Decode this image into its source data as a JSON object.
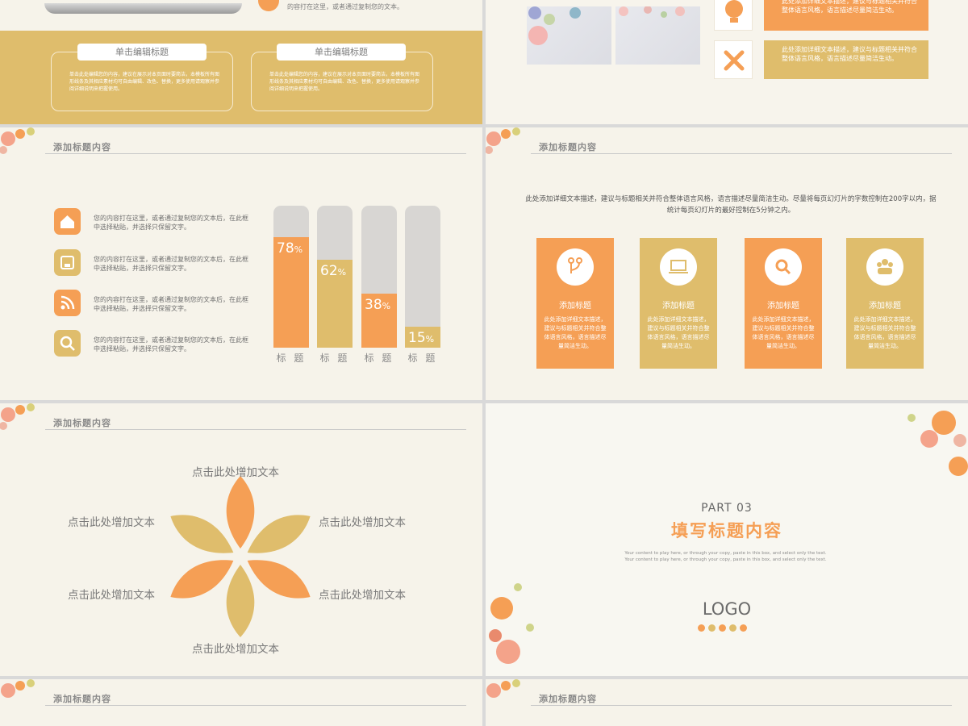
{
  "colors": {
    "orange": "#f59f55",
    "gold": "#dfbd6c",
    "grey": "#d8d6d3",
    "bg": "#f6f3ea"
  },
  "slide_tl": {
    "top_text_1": "的容打在这里，或者通过复制您的文本。",
    "cards": [
      {
        "title": "单击编辑标题",
        "text": "单击此处编辑您的内容，建议在展示对本页面时要简洁，本模板所有图形线条及其相应素材均可自由编辑、改色、替换，更多使用请观察并参阅详细说明来把握使用。"
      },
      {
        "title": "单击编辑标题",
        "text": "单击此处编辑您的内容，建议在展示对本页面时要简洁，本模板所有图形线条及其相应素材均可自由编辑、改色、替换，更多使用请观察并参阅详细说明来把握使用。"
      }
    ]
  },
  "slide_tr": {
    "boxes": [
      {
        "text": "此处添加详细文本描述，建议与标题相关并符合整体语言风格，语言描述尽量简洁生动。"
      },
      {
        "text": "此处添加详细文本描述，建议与标题相关并符合整体语言风格，语言描述尽量简洁生动。"
      }
    ],
    "icons": [
      "lightbulb-icon",
      "tools-icon"
    ]
  },
  "slide_ml": {
    "heading": "添加标题内容",
    "items": [
      {
        "icon": "home-icon",
        "text": "您的内容打在这里，或者通过复制您的文本后，在此框中选择粘贴，并选择只保留文字。"
      },
      {
        "icon": "save-icon",
        "text": "您的内容打在这里，或者通过复制您的文本后，在此框中选择粘贴，并选择只保留文字。"
      },
      {
        "icon": "rss-icon",
        "text": "您的内容打在这里，或者通过复制您的文本后，在此框中选择粘贴，并选择只保留文字。"
      },
      {
        "icon": "search-icon",
        "text": "您的内容打在这里，或者通过复制您的文本后，在此框中选择粘贴，并选择只保留文字。"
      }
    ]
  },
  "chart_data": {
    "type": "bar",
    "categories": [
      "标 题",
      "标 题",
      "标 题",
      "标 题"
    ],
    "values": [
      78,
      62,
      38,
      15
    ],
    "value_labels": [
      "78",
      "62",
      "38",
      "15"
    ],
    "unit": "%",
    "ylim": [
      0,
      100
    ],
    "bar_colors": [
      "#f59f55",
      "#dfbd6c",
      "#f59f55",
      "#dfbd6c"
    ],
    "title": "",
    "grid": false
  },
  "slide_mr": {
    "heading": "添加标题内容",
    "desc": "此处添加详细文本描述，建议与标题相关并符合整体语言风格，语言描述尽量简洁生动。尽量将每页幻灯片的字数控制在200字以内，据统计每页幻灯片的最好控制在5分钟之内。",
    "cards": [
      {
        "icon": "fork-icon",
        "title": "添加标题",
        "text": "此处添加详细文本描述，建议与标题相关并符合整体语言风格，语言描述尽量简洁生动。"
      },
      {
        "icon": "laptop-icon",
        "title": "添加标题",
        "text": "此处添加详细文本描述，建议与标题相关并符合整体语言风格，语言描述尽量简洁生动。"
      },
      {
        "icon": "search-icon",
        "title": "添加标题",
        "text": "此处添加详细文本描述，建议与标题相关并符合整体语言风格，语言描述尽量简洁生动。"
      },
      {
        "icon": "group-icon",
        "title": "添加标题",
        "text": "此处添加详细文本描述，建议与标题相关并符合整体语言风格，语言描述尽量简洁生动。"
      }
    ]
  },
  "slide_ll": {
    "heading": "添加标题内容",
    "labels": [
      "点击此处增加文本",
      "点击此处增加文本",
      "点击此处增加文本",
      "点击此处增加文本",
      "点击此处增加文本",
      "点击此处增加文本"
    ]
  },
  "slide_lr": {
    "part": "PART 03",
    "title": "填写标题内容",
    "small_text": "Your content to play here, or through your copy, paste in this box, and select only the text. Your content to play here, or through your copy, paste in this box, and select only the text.",
    "logo": "LOGO"
  },
  "slide_bl": {
    "heading": "添加标题内容"
  },
  "slide_br": {
    "heading": "添加标题内容"
  }
}
